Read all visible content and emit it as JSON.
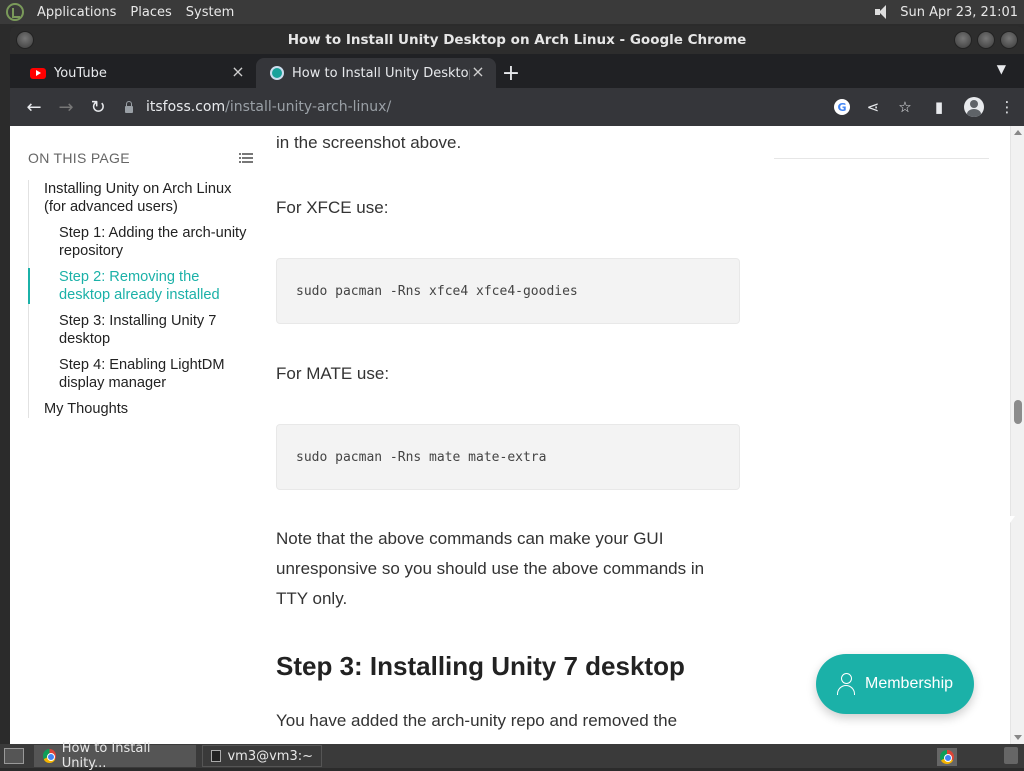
{
  "desktop": {
    "menus": [
      "Applications",
      "Places",
      "System"
    ],
    "clock": "Sun Apr 23, 21:01"
  },
  "window": {
    "title": "How to Install Unity Desktop on Arch Linux - Google Chrome"
  },
  "tabs": [
    {
      "title": "YouTube",
      "icon": "youtube-icon",
      "active": false
    },
    {
      "title": "How to Install Unity Desktop o",
      "icon": "itsfoss-icon",
      "active": true
    }
  ],
  "omnibox": {
    "host": "itsfoss.com",
    "path": "/install-unity-arch-linux/"
  },
  "toc": {
    "heading": "ON THIS PAGE",
    "items": [
      {
        "label": "Installing Unity on Arch Linux (for advanced users)",
        "level": 1,
        "active": false
      },
      {
        "label": "Step 1: Adding the arch-unity repository",
        "level": 2,
        "active": false
      },
      {
        "label": "Step 2: Removing the desktop already installed",
        "level": 2,
        "active": true
      },
      {
        "label": "Step 3: Installing Unity 7 desktop",
        "level": 2,
        "active": false
      },
      {
        "label": "Step 4: Enabling LightDM display manager",
        "level": 2,
        "active": false
      },
      {
        "label": "My Thoughts",
        "level": 1,
        "active": false
      }
    ]
  },
  "article": {
    "intro_tail": "in the screenshot above.",
    "xfce_label": "For XFCE use:",
    "xfce_cmd": "sudo pacman -Rns xfce4 xfce4-goodies",
    "mate_label": "For MATE use:",
    "mate_cmd": "sudo pacman -Rns mate mate-extra",
    "note": "Note that the above commands can make your GUI unresponsive so you should use the above commands in TTY only.",
    "step3_heading": "Step 3: Installing Unity 7 desktop",
    "step3_text": "You have added the arch-unity repo and removed the"
  },
  "membership_label": "Membership",
  "accent_color": "#1bb1a8",
  "taskbar": {
    "tasks": [
      {
        "label": "How to Install Unity...",
        "icon": "chrome-icon",
        "active": true
      },
      {
        "label": "vm3@vm3:~",
        "icon": "terminal-icon",
        "active": false
      }
    ]
  }
}
